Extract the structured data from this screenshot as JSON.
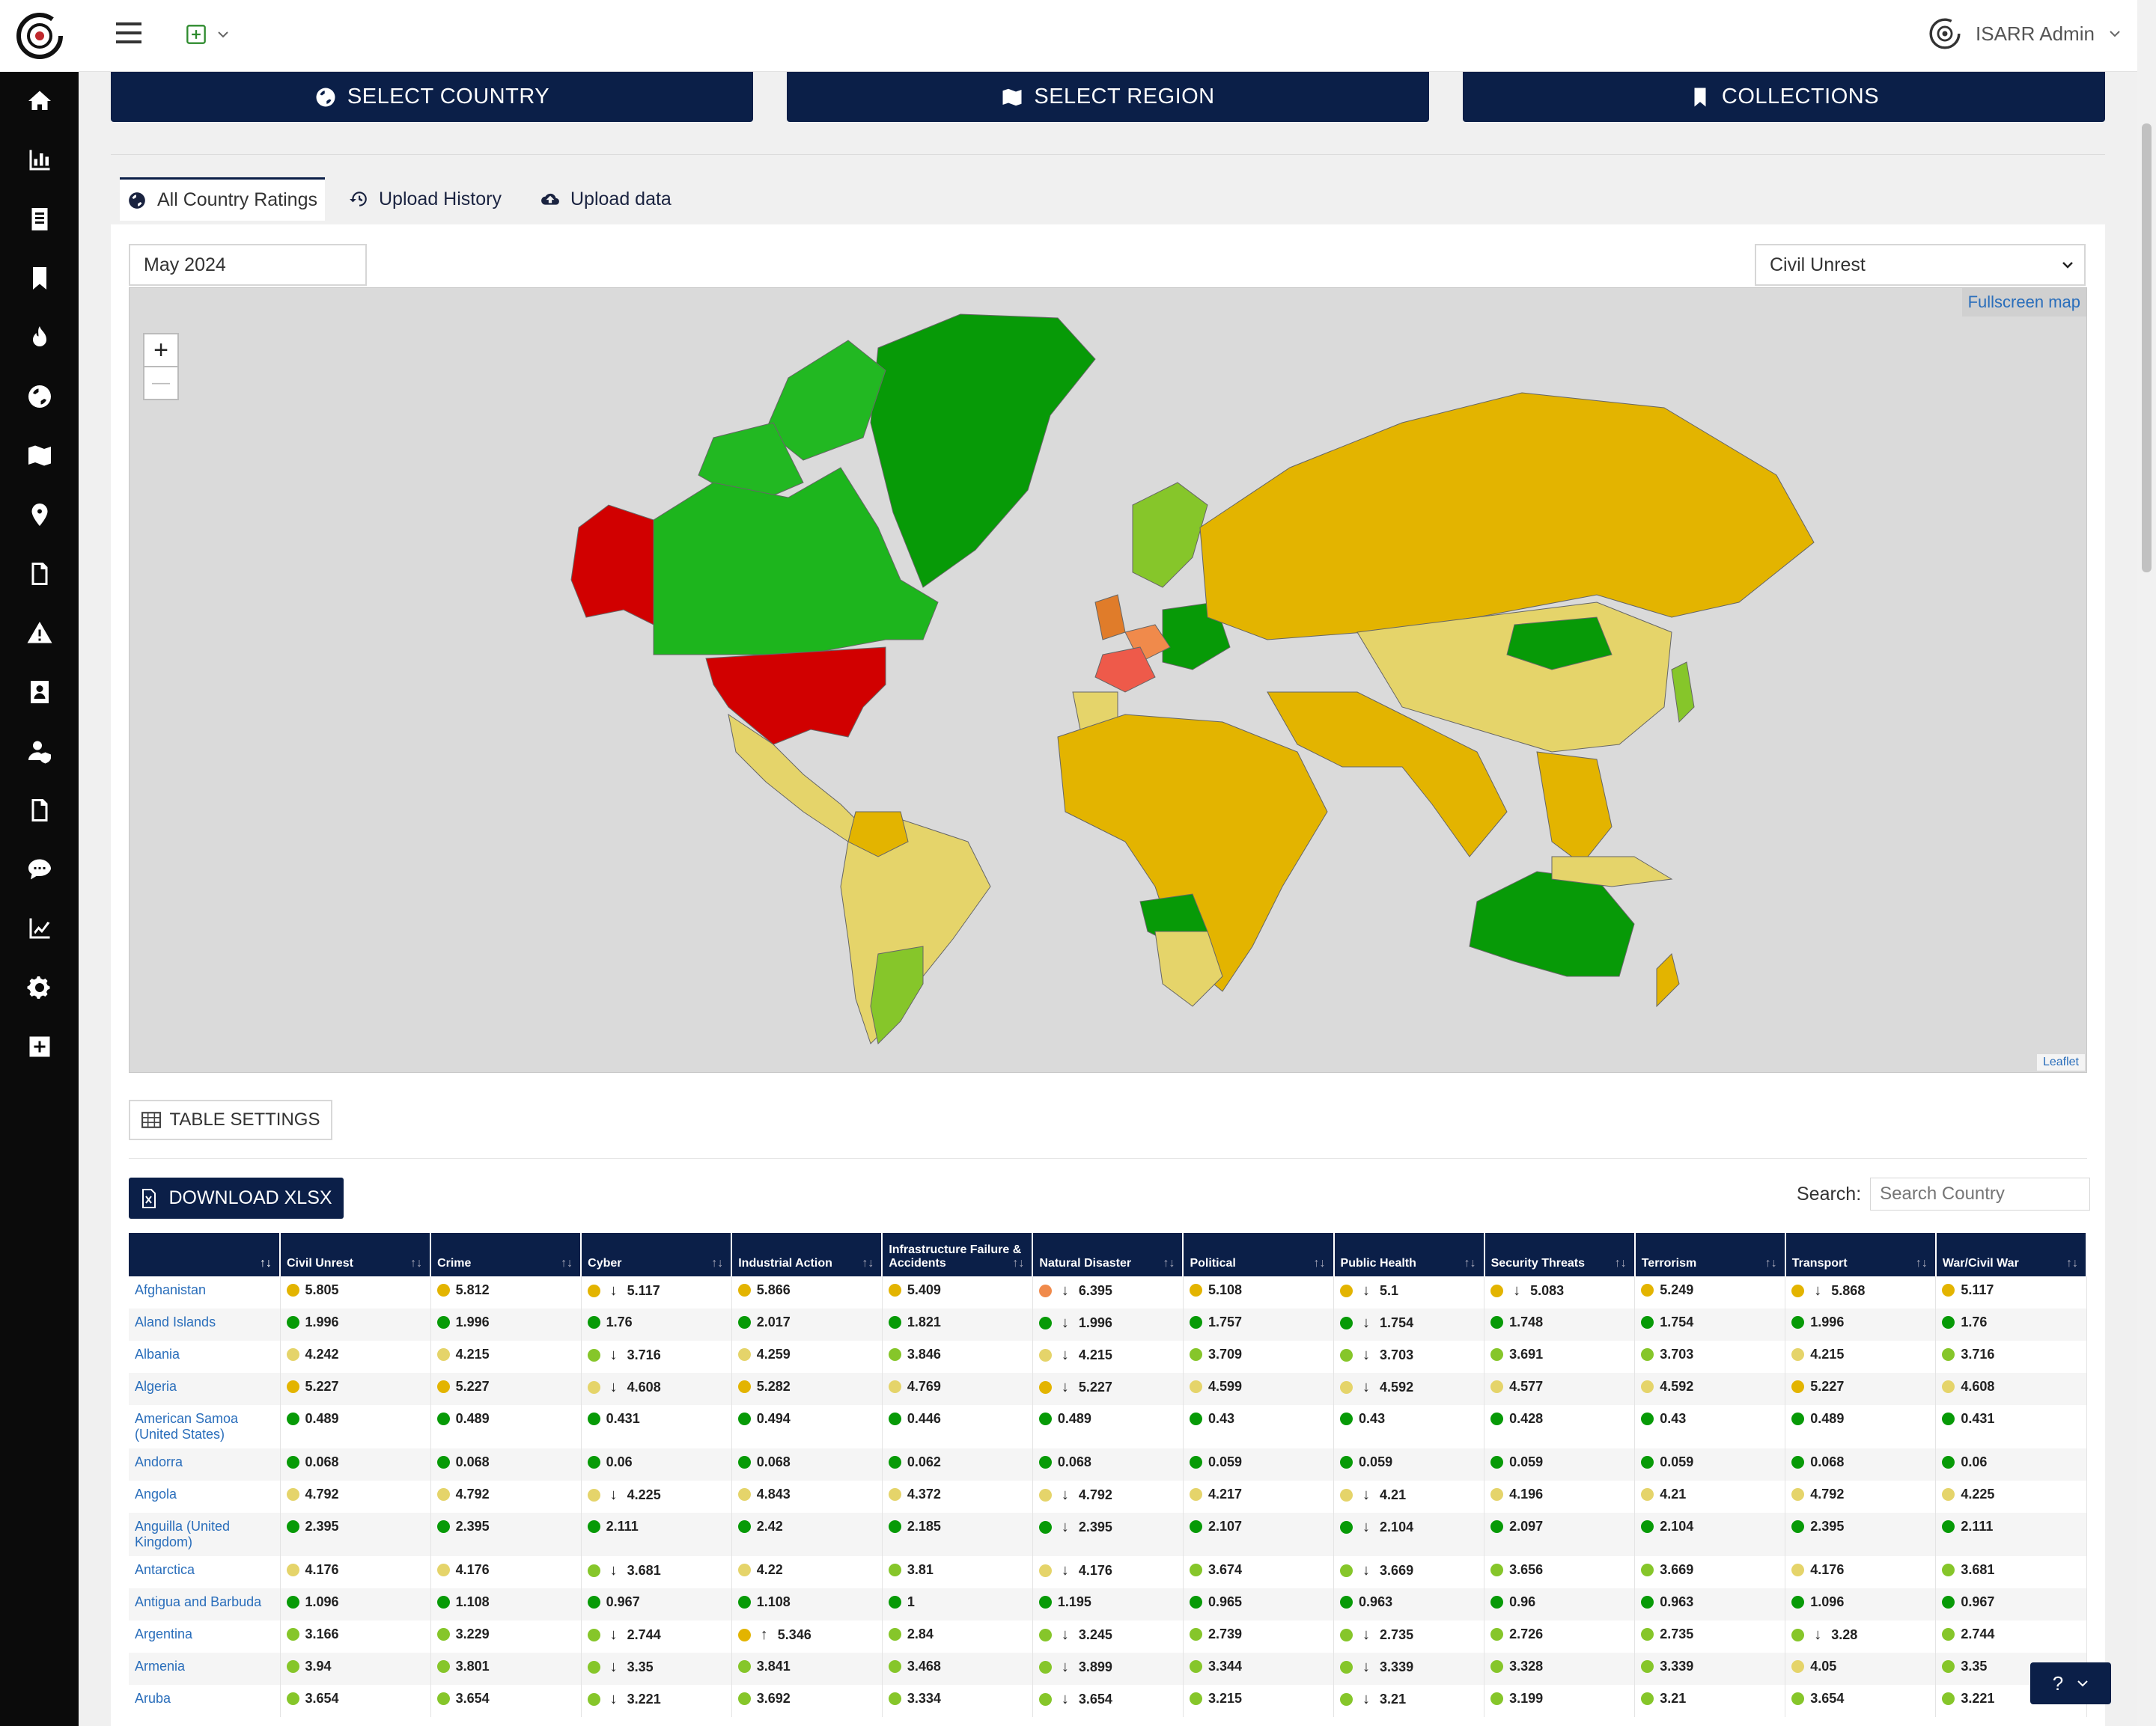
{
  "header": {
    "user_name": "ISARR Admin"
  },
  "nav": {
    "select_country": "SELECT COUNTRY",
    "select_region": "SELECT REGION",
    "collections": "COLLECTIONS"
  },
  "tabs": [
    {
      "label": "All Country Ratings"
    },
    {
      "label": "Upload History"
    },
    {
      "label": "Upload data"
    }
  ],
  "filters": {
    "date_value": "May 2024",
    "category_value": "Civil Unrest"
  },
  "map": {
    "fullscreen_label": "Fullscreen map",
    "attribution": "Leaflet",
    "zoom_in": "+",
    "zoom_out": "—"
  },
  "table_settings_label": "TABLE SETTINGS",
  "download_label": "DOWNLOAD XLSX",
  "search": {
    "label": "Search:",
    "placeholder": "Search Country"
  },
  "help_label": "?",
  "table": {
    "columns": [
      "Civil Unrest",
      "Crime",
      "Cyber",
      "Industrial Action",
      "Infrastructure Failure & Accidents",
      "Natural Disaster",
      "Political",
      "Public Health",
      "Security Threats",
      "Terrorism",
      "Transport",
      "War/Civil War"
    ],
    "rows": [
      {
        "country": "Afghanistan",
        "cells": [
          [
            "5.805",
            "o",
            ""
          ],
          [
            "5.812",
            "o",
            ""
          ],
          [
            "5.117",
            "o",
            "d"
          ],
          [
            "5.866",
            "o",
            ""
          ],
          [
            "5.409",
            "o",
            ""
          ],
          [
            "6.395",
            "r",
            "d"
          ],
          [
            "5.108",
            "o",
            ""
          ],
          [
            "5.1",
            "o",
            "d"
          ],
          [
            "5.083",
            "o",
            "d"
          ],
          [
            "5.249",
            "o",
            ""
          ],
          [
            "5.868",
            "o",
            "d"
          ],
          [
            "5.117",
            "o",
            ""
          ]
        ]
      },
      {
        "country": "Aland Islands",
        "cells": [
          [
            "1.996",
            "g",
            ""
          ],
          [
            "1.996",
            "g",
            ""
          ],
          [
            "1.76",
            "g",
            ""
          ],
          [
            "2.017",
            "g",
            ""
          ],
          [
            "1.821",
            "g",
            ""
          ],
          [
            "1.996",
            "g",
            "d"
          ],
          [
            "1.757",
            "g",
            ""
          ],
          [
            "1.754",
            "g",
            "d"
          ],
          [
            "1.748",
            "g",
            ""
          ],
          [
            "1.754",
            "g",
            ""
          ],
          [
            "1.996",
            "g",
            ""
          ],
          [
            "1.76",
            "g",
            ""
          ]
        ]
      },
      {
        "country": "Albania",
        "cells": [
          [
            "4.242",
            "y",
            ""
          ],
          [
            "4.215",
            "y",
            ""
          ],
          [
            "3.716",
            "l",
            "d"
          ],
          [
            "4.259",
            "y",
            ""
          ],
          [
            "3.846",
            "l",
            ""
          ],
          [
            "4.215",
            "y",
            "d"
          ],
          [
            "3.709",
            "l",
            ""
          ],
          [
            "3.703",
            "l",
            "d"
          ],
          [
            "3.691",
            "l",
            ""
          ],
          [
            "3.703",
            "l",
            ""
          ],
          [
            "4.215",
            "y",
            ""
          ],
          [
            "3.716",
            "l",
            ""
          ]
        ]
      },
      {
        "country": "Algeria",
        "cells": [
          [
            "5.227",
            "o",
            ""
          ],
          [
            "5.227",
            "o",
            ""
          ],
          [
            "4.608",
            "y",
            "d"
          ],
          [
            "5.282",
            "o",
            ""
          ],
          [
            "4.769",
            "y",
            ""
          ],
          [
            "5.227",
            "o",
            "d"
          ],
          [
            "4.599",
            "y",
            ""
          ],
          [
            "4.592",
            "y",
            "d"
          ],
          [
            "4.577",
            "y",
            ""
          ],
          [
            "4.592",
            "y",
            ""
          ],
          [
            "5.227",
            "o",
            ""
          ],
          [
            "4.608",
            "y",
            ""
          ]
        ]
      },
      {
        "country": "American Samoa (United States)",
        "cells": [
          [
            "0.489",
            "g",
            ""
          ],
          [
            "0.489",
            "g",
            ""
          ],
          [
            "0.431",
            "g",
            ""
          ],
          [
            "0.494",
            "g",
            ""
          ],
          [
            "0.446",
            "g",
            ""
          ],
          [
            "0.489",
            "g",
            ""
          ],
          [
            "0.43",
            "g",
            ""
          ],
          [
            "0.43",
            "g",
            ""
          ],
          [
            "0.428",
            "g",
            ""
          ],
          [
            "0.43",
            "g",
            ""
          ],
          [
            "0.489",
            "g",
            ""
          ],
          [
            "0.431",
            "g",
            ""
          ]
        ]
      },
      {
        "country": "Andorra",
        "cells": [
          [
            "0.068",
            "g",
            ""
          ],
          [
            "0.068",
            "g",
            ""
          ],
          [
            "0.06",
            "g",
            ""
          ],
          [
            "0.068",
            "g",
            ""
          ],
          [
            "0.062",
            "g",
            ""
          ],
          [
            "0.068",
            "g",
            ""
          ],
          [
            "0.059",
            "g",
            ""
          ],
          [
            "0.059",
            "g",
            ""
          ],
          [
            "0.059",
            "g",
            ""
          ],
          [
            "0.059",
            "g",
            ""
          ],
          [
            "0.068",
            "g",
            ""
          ],
          [
            "0.06",
            "g",
            ""
          ]
        ]
      },
      {
        "country": "Angola",
        "cells": [
          [
            "4.792",
            "y",
            ""
          ],
          [
            "4.792",
            "y",
            ""
          ],
          [
            "4.225",
            "y",
            "d"
          ],
          [
            "4.843",
            "y",
            ""
          ],
          [
            "4.372",
            "y",
            ""
          ],
          [
            "4.792",
            "y",
            "d"
          ],
          [
            "4.217",
            "y",
            ""
          ],
          [
            "4.21",
            "y",
            "d"
          ],
          [
            "4.196",
            "y",
            ""
          ],
          [
            "4.21",
            "y",
            ""
          ],
          [
            "4.792",
            "y",
            ""
          ],
          [
            "4.225",
            "y",
            ""
          ]
        ]
      },
      {
        "country": "Anguilla (United Kingdom)",
        "cells": [
          [
            "2.395",
            "g",
            ""
          ],
          [
            "2.395",
            "g",
            ""
          ],
          [
            "2.111",
            "g",
            ""
          ],
          [
            "2.42",
            "g",
            ""
          ],
          [
            "2.185",
            "g",
            ""
          ],
          [
            "2.395",
            "g",
            "d"
          ],
          [
            "2.107",
            "g",
            ""
          ],
          [
            "2.104",
            "g",
            "d"
          ],
          [
            "2.097",
            "g",
            ""
          ],
          [
            "2.104",
            "g",
            ""
          ],
          [
            "2.395",
            "g",
            ""
          ],
          [
            "2.111",
            "g",
            ""
          ]
        ]
      },
      {
        "country": "Antarctica",
        "cells": [
          [
            "4.176",
            "y",
            ""
          ],
          [
            "4.176",
            "y",
            ""
          ],
          [
            "3.681",
            "l",
            "d"
          ],
          [
            "4.22",
            "y",
            ""
          ],
          [
            "3.81",
            "l",
            ""
          ],
          [
            "4.176",
            "y",
            "d"
          ],
          [
            "3.674",
            "l",
            ""
          ],
          [
            "3.669",
            "l",
            "d"
          ],
          [
            "3.656",
            "l",
            ""
          ],
          [
            "3.669",
            "l",
            ""
          ],
          [
            "4.176",
            "y",
            ""
          ],
          [
            "3.681",
            "l",
            ""
          ]
        ]
      },
      {
        "country": "Antigua and Barbuda",
        "cells": [
          [
            "1.096",
            "g",
            ""
          ],
          [
            "1.108",
            "g",
            ""
          ],
          [
            "0.967",
            "g",
            ""
          ],
          [
            "1.108",
            "g",
            ""
          ],
          [
            "1",
            "g",
            ""
          ],
          [
            "1.195",
            "g",
            ""
          ],
          [
            "0.965",
            "g",
            ""
          ],
          [
            "0.963",
            "g",
            ""
          ],
          [
            "0.96",
            "g",
            ""
          ],
          [
            "0.963",
            "g",
            ""
          ],
          [
            "1.096",
            "g",
            ""
          ],
          [
            "0.967",
            "g",
            ""
          ]
        ]
      },
      {
        "country": "Argentina",
        "cells": [
          [
            "3.166",
            "l",
            ""
          ],
          [
            "3.229",
            "l",
            ""
          ],
          [
            "2.744",
            "l",
            "d"
          ],
          [
            "5.346",
            "o",
            "u"
          ],
          [
            "2.84",
            "l",
            ""
          ],
          [
            "3.245",
            "l",
            "d"
          ],
          [
            "2.739",
            "l",
            ""
          ],
          [
            "2.735",
            "l",
            "d"
          ],
          [
            "2.726",
            "l",
            ""
          ],
          [
            "2.735",
            "l",
            ""
          ],
          [
            "3.28",
            "l",
            "d"
          ],
          [
            "2.744",
            "l",
            ""
          ]
        ]
      },
      {
        "country": "Armenia",
        "cells": [
          [
            "3.94",
            "l",
            ""
          ],
          [
            "3.801",
            "l",
            ""
          ],
          [
            "3.35",
            "l",
            "d"
          ],
          [
            "3.841",
            "l",
            ""
          ],
          [
            "3.468",
            "l",
            ""
          ],
          [
            "3.899",
            "l",
            "d"
          ],
          [
            "3.344",
            "l",
            ""
          ],
          [
            "3.339",
            "l",
            "d"
          ],
          [
            "3.328",
            "l",
            ""
          ],
          [
            "3.339",
            "l",
            ""
          ],
          [
            "4.05",
            "y",
            ""
          ],
          [
            "3.35",
            "l",
            ""
          ]
        ]
      },
      {
        "country": "Aruba",
        "cells": [
          [
            "3.654",
            "l",
            ""
          ],
          [
            "3.654",
            "l",
            ""
          ],
          [
            "3.221",
            "l",
            "d"
          ],
          [
            "3.692",
            "l",
            ""
          ],
          [
            "3.334",
            "l",
            ""
          ],
          [
            "3.654",
            "l",
            "d"
          ],
          [
            "3.215",
            "l",
            ""
          ],
          [
            "3.21",
            "l",
            "d"
          ],
          [
            "3.199",
            "l",
            ""
          ],
          [
            "3.21",
            "l",
            ""
          ],
          [
            "3.654",
            "l",
            ""
          ],
          [
            "3.221",
            "l",
            ""
          ]
        ]
      }
    ]
  },
  "colors": {
    "navy": "#0b1f48",
    "rating_green": "#079a07",
    "rating_lightgreen": "#86c62a",
    "rating_yellow": "#e5d46a",
    "rating_orange": "#e3b400",
    "rating_red": "#d10000",
    "rating_redorange": "#f08a4b"
  }
}
